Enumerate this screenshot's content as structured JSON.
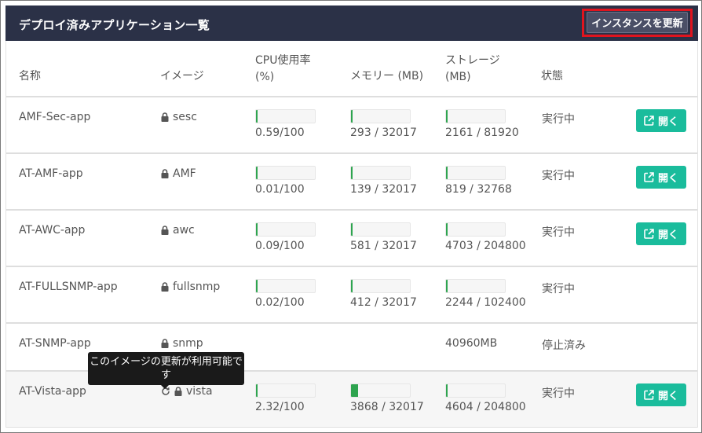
{
  "header": {
    "title": "デプロイ済みアプリケーション一覧",
    "refresh_label": "インスタンスを更新"
  },
  "columns": {
    "name": "名称",
    "image": "イメージ",
    "cpu_line1": "CPU使用率",
    "cpu_line2": "(%)",
    "memory": "メモリー (MB)",
    "storage_line1": "ストレージ",
    "storage_line2": "(MB)",
    "status": "状態"
  },
  "open_label": "開く",
  "tooltip": "このイメージの更新が利用可能です",
  "colors": {
    "header_bg": "#2b3147",
    "accent": "#1abc9c",
    "bar_fill": "#2ea44f",
    "highlight": "#e0141e"
  },
  "rows": [
    {
      "name": "AMF-Sec-app",
      "image": "sesc",
      "cpu": "0.59/100",
      "cpu_pct": 0.59,
      "memory": "293 / 32017",
      "mem_pct": 0.92,
      "storage": "2161 / 81920",
      "sto_pct": 2.64,
      "status": "実行中",
      "open": true
    },
    {
      "name": "AT-AMF-app",
      "image": "AMF",
      "cpu": "0.01/100",
      "cpu_pct": 0.01,
      "memory": "139 / 32017",
      "mem_pct": 0.43,
      "storage": "819 / 32768",
      "sto_pct": 2.5,
      "status": "実行中",
      "open": true
    },
    {
      "name": "AT-AWC-app",
      "image": "awc",
      "cpu": "0.09/100",
      "cpu_pct": 0.09,
      "memory": "581 / 32017",
      "mem_pct": 1.81,
      "storage": "4703 / 204800",
      "sto_pct": 2.3,
      "status": "実行中",
      "open": true
    },
    {
      "name": "AT-FULLSNMP-app",
      "image": "fullsnmp",
      "cpu": "0.02/100",
      "cpu_pct": 0.02,
      "memory": "412 / 32017",
      "mem_pct": 1.29,
      "storage": "2244 / 102400",
      "sto_pct": 2.19,
      "status": "実行中",
      "open": false
    },
    {
      "name": "AT-SNMP-app",
      "image": "snmp",
      "storage_text": "40960MB",
      "status": "停止済み",
      "open": false
    },
    {
      "name": "AT-Vista-app",
      "image": "vista",
      "cpu": "2.32/100",
      "cpu_pct": 2.32,
      "memory": "3868 / 32017",
      "mem_pct": 12.08,
      "storage": "4604 / 204800",
      "sto_pct": 2.25,
      "status": "実行中",
      "open": true,
      "update_available": true
    }
  ]
}
